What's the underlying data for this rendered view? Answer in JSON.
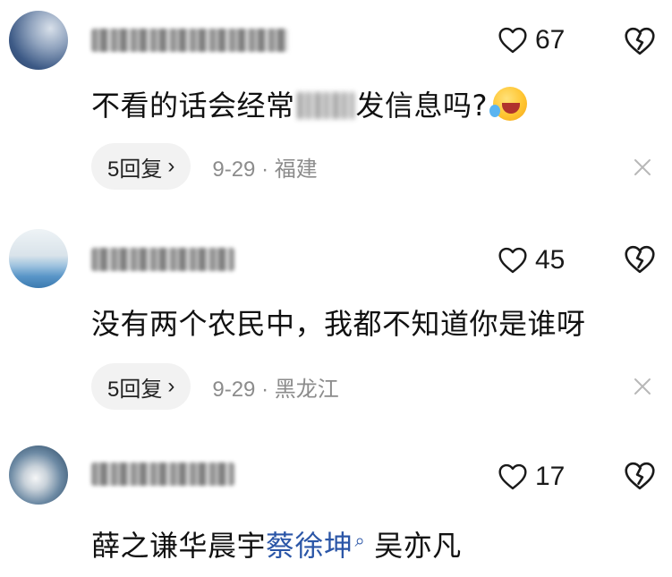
{
  "comments": [
    {
      "username": "",
      "like_count": "67",
      "text_before": "不看的话会经常",
      "text_after": "发信息吗?",
      "reply_label": "5回复",
      "date": "9-29",
      "dot": "·",
      "location": "福建"
    },
    {
      "username": "",
      "like_count": "45",
      "text": "没有两个农民中，我都不知道你是谁呀",
      "reply_label": "5回复",
      "date": "9-29",
      "dot": "·",
      "location": "黑龙江"
    },
    {
      "username": "",
      "like_count": "17",
      "text_before": "薛之谦华晨宇",
      "link_text": "蔡徐坤",
      "text_after": "吴亦凡"
    }
  ],
  "icons": {
    "like": "heart-outline-icon",
    "dislike": "broken-heart-icon",
    "close": "close-icon",
    "chevron": "›",
    "search_hint": "search-icon"
  },
  "colors": {
    "link": "#2b56a7",
    "meta": "#8c8c8c",
    "reply_bg": "#f2f2f2"
  }
}
